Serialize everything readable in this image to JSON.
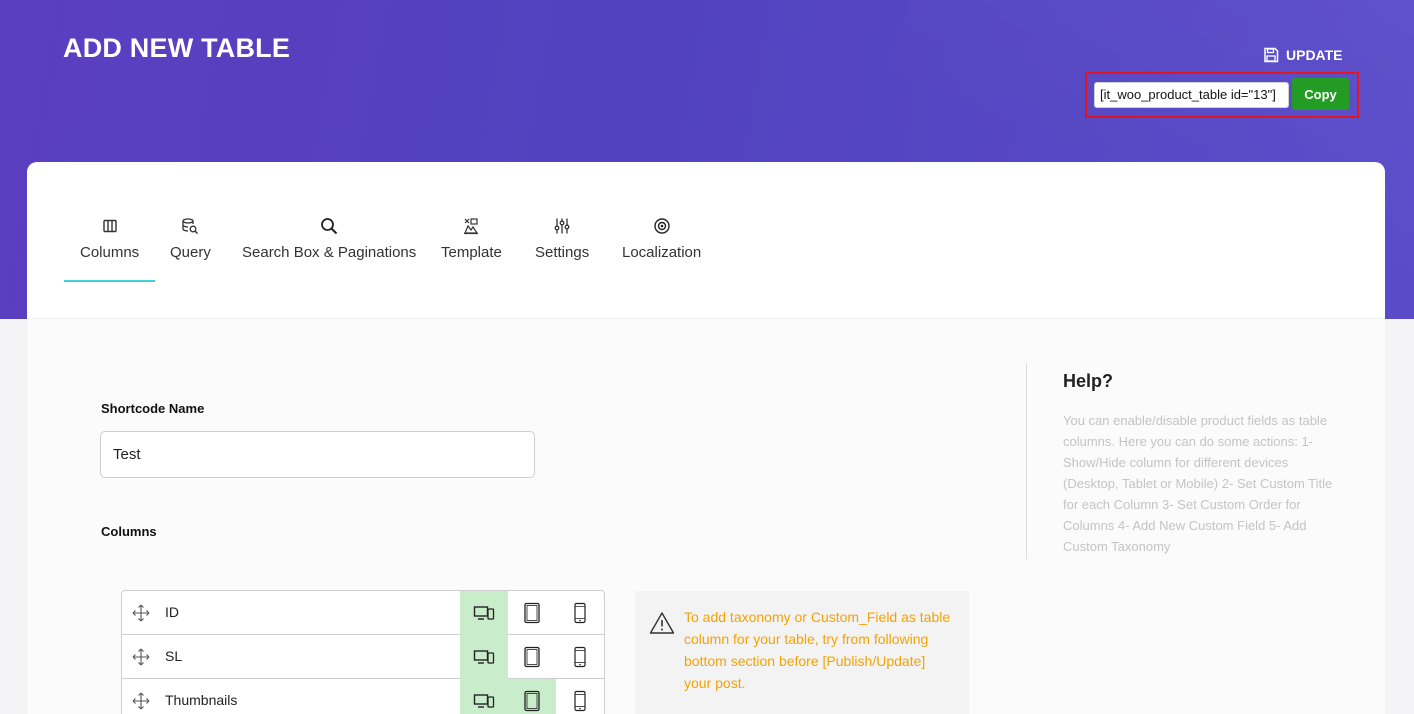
{
  "header": {
    "title": "ADD NEW TABLE",
    "update_label": "UPDATE",
    "shortcode_value": "[it_woo_product_table id=\"13\"]",
    "copy_label": "Copy"
  },
  "tabs": [
    {
      "label": "Columns",
      "icon": "columns-icon",
      "active": true
    },
    {
      "label": "Query",
      "icon": "database-search-icon"
    },
    {
      "label": "Search Box & Paginations",
      "icon": "search-icon"
    },
    {
      "label": "Template",
      "icon": "template-icon"
    },
    {
      "label": "Settings",
      "icon": "sliders-icon"
    },
    {
      "label": "Localization",
      "icon": "target-icon"
    }
  ],
  "form": {
    "shortcode_name_label": "Shortcode Name",
    "shortcode_name_value": "Test",
    "columns_label": "Columns"
  },
  "columns": [
    {
      "name": "ID",
      "desktop": true,
      "tablet": false,
      "mobile": false
    },
    {
      "name": "SL",
      "desktop": true,
      "tablet": false,
      "mobile": false
    },
    {
      "name": "Thumbnails",
      "desktop": true,
      "tablet": true,
      "mobile": false
    }
  ],
  "notice": {
    "text": "To add taxonomy or Custom_Field as table column for your table, try from following bottom section before [Publish/Update] your post.",
    "icon": "warning-icon",
    "color": "#f5a300"
  },
  "help": {
    "title": "Help?",
    "text": "You can enable/disable product fields as table columns. Here you can do some actions: 1- Show/Hide column for different devices (Desktop, Tablet or Mobile) 2- Set Custom Title for each Column 3- Set Custom Order for Columns 4- Add New Custom Field 5- Add Custom Taxonomy"
  },
  "colors": {
    "header_bg": "#5242bf",
    "copy_button": "#1f9a1f",
    "highlight_border": "#e0121f",
    "active_tab_underline": "#3fd0d8",
    "device_enabled": "#c9edcb"
  }
}
